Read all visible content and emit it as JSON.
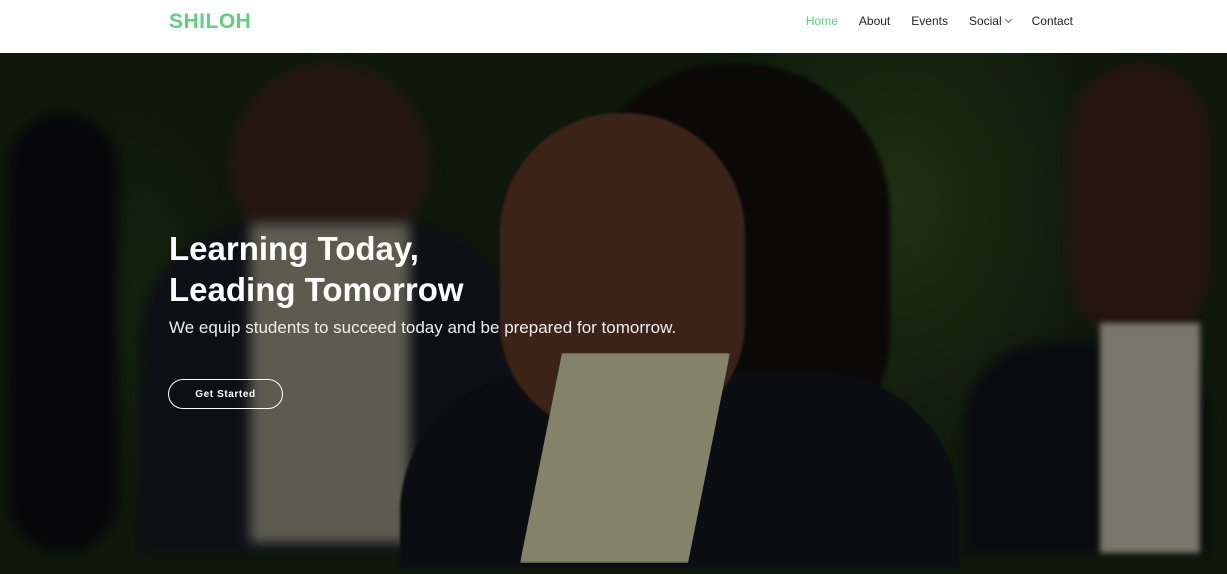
{
  "header": {
    "logo": "SHILOH",
    "nav": [
      {
        "label": "Home",
        "active": true
      },
      {
        "label": "About"
      },
      {
        "label": "Events"
      },
      {
        "label": "Social",
        "dropdown": true
      },
      {
        "label": "Contact"
      }
    ]
  },
  "hero": {
    "title_line1": "Learning Today,",
    "title_line2": "Leading Tomorrow",
    "subtitle": "We equip students to succeed today and be prepared for tomorrow.",
    "cta": "Get Started"
  },
  "colors": {
    "accent": "#5fcf80"
  }
}
